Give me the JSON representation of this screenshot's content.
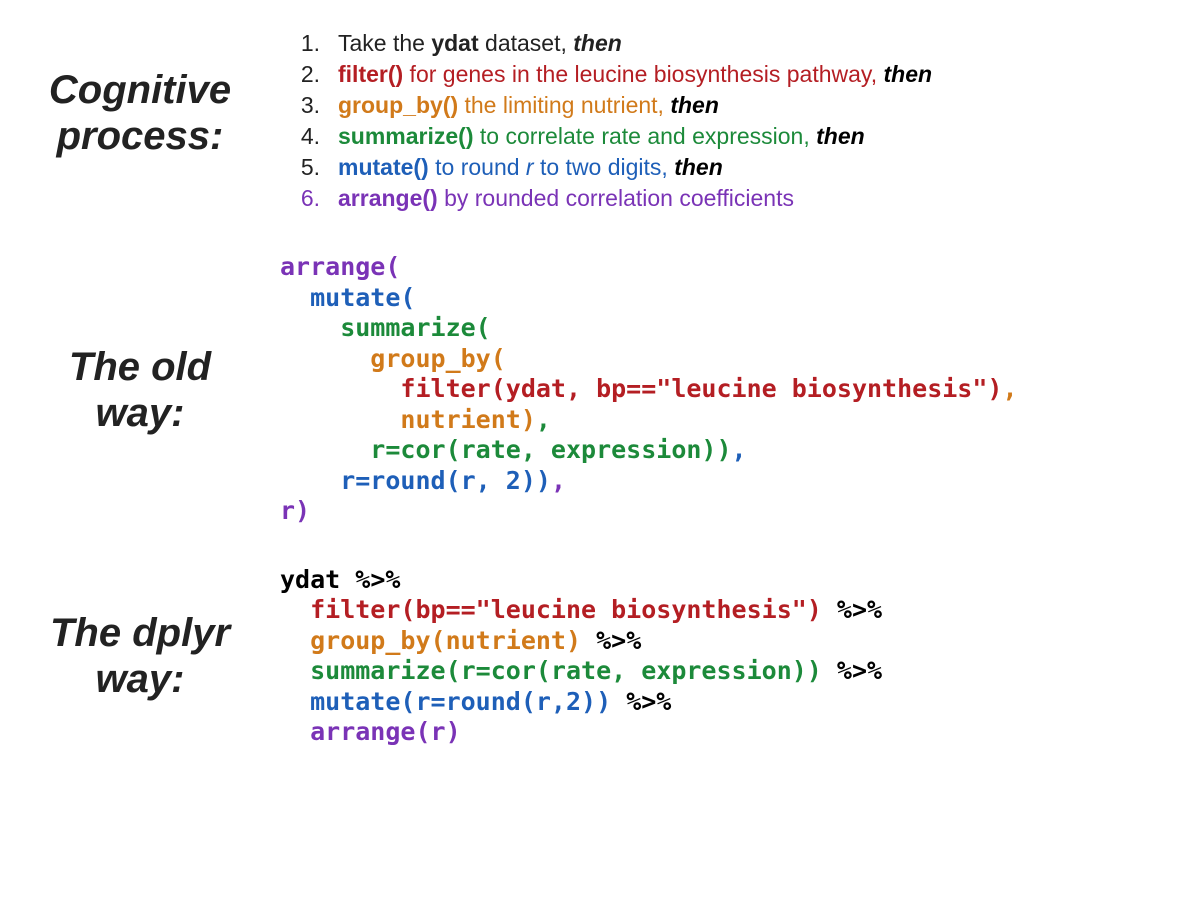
{
  "labels": {
    "cognitive_l1": "Cognitive",
    "cognitive_l2": "process:",
    "oldway_l1": "The old",
    "oldway_l2": "way:",
    "dplyr_l1": "The dplyr",
    "dplyr_l2": "way:"
  },
  "steps": {
    "n1": "1.",
    "n2": "2.",
    "n3": "3.",
    "n4": "4.",
    "n5": "5.",
    "n6": "6.",
    "s1_a": "Take the ",
    "s1_b": "ydat",
    "s1_c": " dataset, ",
    "then": "then",
    "s2_fn": "filter()",
    "s2_rest": " for genes in the leucine biosynthesis pathway, ",
    "s3_fn": "group_by()",
    "s3_rest": " the limiting nutrient, ",
    "s4_fn": "summarize()",
    "s4_rest": " to correlate rate and expression, ",
    "s5_fn": "mutate()",
    "s5_rest": " to round ",
    "s5_r": "r",
    "s5_rest2": " to two digits, ",
    "s6_fn": "arrange()",
    "s6_rest": " by rounded correlation coefficients"
  },
  "old": {
    "l1": "arrange(",
    "l2": "  mutate(",
    "l3": "    summarize(",
    "l4": "      group_by(",
    "l5a": "        filter(ydat, bp==\"leucine biosynthesis\")",
    "l5b": ",",
    "l6a": "        nutrient)",
    "l6b": ",",
    "l7a": "      r=cor(rate, expression))",
    "l7b": ",",
    "l8a": "    r=round(r, 2))",
    "l8b": ",",
    "l9": "r)"
  },
  "dplyr": {
    "l1a": "ydat ",
    "pipe": "%>%",
    "l2a": "  filter(bp==\"leucine biosynthesis\")",
    "l3a": "  group_by(nutrient)",
    "l4a": "  summarize(r=cor(rate, expression))",
    "l5a": "  mutate(r=round(r,2))",
    "l6a": "  arrange(r)"
  }
}
